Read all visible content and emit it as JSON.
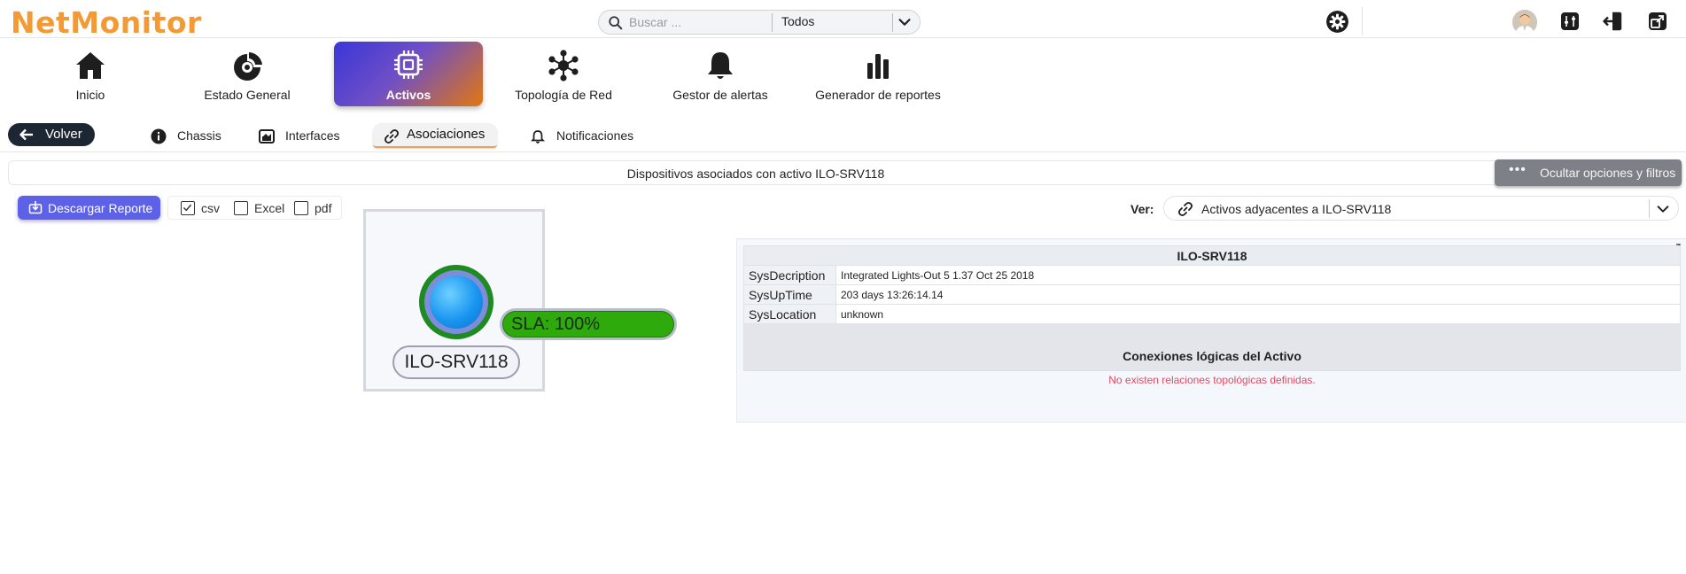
{
  "app": {
    "logo": "NetMonitor",
    "brand_color": "#f39a34"
  },
  "search": {
    "placeholder": "Buscar ...",
    "value": "",
    "scope": "Todos"
  },
  "header_icons": [
    "gear-icon",
    "avatar",
    "equalizer-icon",
    "logout-icon",
    "external-link-icon"
  ],
  "modules": [
    {
      "label": "Inicio",
      "icon": "home-icon"
    },
    {
      "label": "Estado General",
      "icon": "dashboard-icon"
    },
    {
      "label": "Activos",
      "icon": "chip-icon",
      "active": true
    },
    {
      "label": "Topología de Red",
      "icon": "topology-icon"
    },
    {
      "label": "Gestor de alertas",
      "icon": "bell-icon"
    },
    {
      "label": "Generador de reportes",
      "icon": "bar-chart-icon"
    }
  ],
  "subnav": {
    "back": "Volver",
    "tabs": [
      {
        "label": "Chassis",
        "icon": "info-icon"
      },
      {
        "label": "Interfaces",
        "icon": "image-icon"
      },
      {
        "label": "Asociaciones",
        "icon": "link-icon",
        "active": true
      },
      {
        "label": "Notificaciones",
        "icon": "bell-icon"
      }
    ]
  },
  "infobar": {
    "title": "Dispositivos asociados con activo ILO-SRV118",
    "filters_button": "Ocultar opciones y filtros"
  },
  "report": {
    "download": "Descargar Reporte",
    "formats": [
      {
        "label": "csv",
        "checked": true
      },
      {
        "label": "Excel",
        "checked": false
      },
      {
        "label": "pdf",
        "checked": false
      }
    ]
  },
  "node": {
    "name": "ILO-SRV118",
    "sla": "SLA: 100%",
    "status_color": "#2eaa0d"
  },
  "view": {
    "label": "Ver:",
    "selected": "Activos adyacentes a ILO-SRV118"
  },
  "details": {
    "title": "ILO-SRV118",
    "rows": [
      {
        "key": "SysDecription",
        "value": "Integrated Lights-Out 5 1.37 Oct 25 2018"
      },
      {
        "key": "SysUpTime",
        "value": "203 days 13:26:14.14"
      },
      {
        "key": "SysLocation",
        "value": "unknown"
      }
    ],
    "connections_title": "Conexiones lógicas del Activo",
    "empty_message": "No existen relaciones topológicas definidas."
  }
}
